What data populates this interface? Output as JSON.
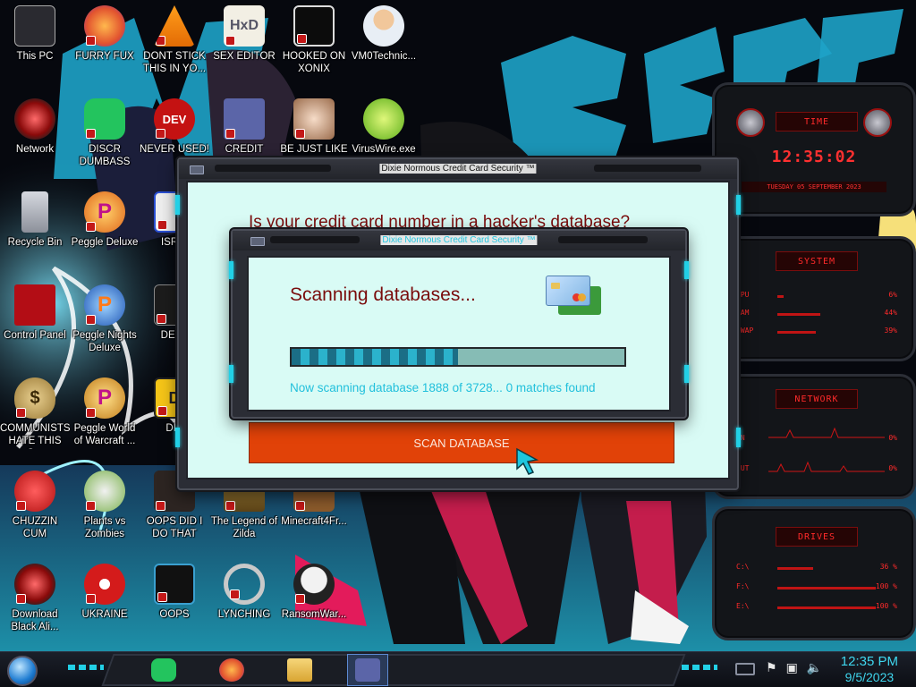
{
  "desktop_icons": [
    {
      "label": "This PC",
      "icon": "this-pc-icon",
      "shortcut": false
    },
    {
      "label": "FURRY FUX",
      "icon": "firefox-icon",
      "shortcut": true
    },
    {
      "label": "DONT STICK THIS IN YO...",
      "icon": "vlc-icon",
      "shortcut": true
    },
    {
      "label": "SEX EDITOR",
      "icon": "hex-editor-icon",
      "shortcut": true
    },
    {
      "label": "HOOKED ON XONIX",
      "icon": "xonix-icon",
      "shortcut": true
    },
    {
      "label": "VM0Technic...",
      "icon": "technician-icon",
      "shortcut": false
    },
    {
      "label": "Network",
      "icon": "network-icon",
      "shortcut": false
    },
    {
      "label": "DISCR DUMBASS",
      "icon": "discord-icon",
      "shortcut": true
    },
    {
      "label": "NEVER USED!",
      "icon": "devcpp-icon",
      "shortcut": true
    },
    {
      "label": "CREDIT CARD",
      "icon": "credit-card-icon",
      "shortcut": true
    },
    {
      "label": "BE JUST LIKE",
      "icon": "santa-icon",
      "shortcut": true
    },
    {
      "label": "VirusWire.exe",
      "icon": "lime-icon",
      "shortcut": false
    },
    {
      "label": "Recycle Bin",
      "icon": "recycle-bin-icon",
      "shortcut": false
    },
    {
      "label": "Peggle Deluxe",
      "icon": "peggle-icon",
      "shortcut": true
    },
    {
      "label": "ISRAI",
      "icon": "israel-icon",
      "shortcut": true
    },
    {
      "label": "Control Panel",
      "icon": "control-panel-icon",
      "shortcut": false
    },
    {
      "label": "Peggle Nights Deluxe",
      "icon": "peggle-nights-icon",
      "shortcut": true
    },
    {
      "label": "DEEZ",
      "icon": "deez-icon",
      "shortcut": true
    },
    {
      "label": "COMMUNISTS HATE THIS G...",
      "icon": "money-bag-icon",
      "shortcut": true
    },
    {
      "label": "Peggle World of Warcraft ...",
      "icon": "peggle-wow-icon",
      "shortcut": true
    },
    {
      "label": "DIE",
      "icon": "die-icon",
      "shortcut": true
    },
    {
      "label": "CHUZZIN CUM",
      "icon": "chuzzle-icon",
      "shortcut": true
    },
    {
      "label": "Plants vs Zombies",
      "icon": "pvz-icon",
      "shortcut": true
    },
    {
      "label": "OOPS DID I DO THAT",
      "icon": "urkel-icon",
      "shortcut": true
    },
    {
      "label": "The Legend of Zilda",
      "icon": "zelda-icon",
      "shortcut": true
    },
    {
      "label": "Minecraft4Fr...",
      "icon": "minecraft-icon",
      "shortcut": true
    },
    {
      "label": "Download Black Ali...",
      "icon": "alienware-icon",
      "shortcut": true
    },
    {
      "label": "UKRAINE",
      "icon": "radiation-icon",
      "shortcut": true
    },
    {
      "label": "OOPS",
      "icon": "oops-icon",
      "shortcut": true
    },
    {
      "label": "LYNCHING",
      "icon": "noose-icon",
      "shortcut": true
    },
    {
      "label": "RansomWar...",
      "icon": "skull-icon",
      "shortcut": true
    }
  ],
  "back_window": {
    "title": "Dixie Normous Credit Card Security ™",
    "question": "Is your credit card number in a hacker's database?",
    "scan_button_label": "SCAN DATABASE"
  },
  "front_window": {
    "title": "Dixie Normous Credit Card Security ™",
    "heading": "Scanning databases...",
    "progress_fraction": 0.5,
    "status_text": "Now scanning database 1888 of 3728... 0 matches found"
  },
  "widgets": {
    "time": {
      "title": "TIME",
      "clock": "12:35:02",
      "date": "TUESDAY 05 SEPTEMBER 2023"
    },
    "system": {
      "title": "SYSTEM",
      "rows": [
        {
          "key": "CPU",
          "value": "6%",
          "level": 0.06
        },
        {
          "key": "RAM",
          "value": "44%",
          "level": 0.44
        },
        {
          "key": "SWAP",
          "value": "39%",
          "level": 0.39
        }
      ]
    },
    "network": {
      "title": "NETWORK",
      "rows": [
        {
          "key": "IN",
          "value": "0%"
        },
        {
          "key": "OUT",
          "value": "0%"
        }
      ]
    },
    "drives": {
      "title": "DRIVES",
      "rows": [
        {
          "key": "C:\\",
          "value": "36 %"
        },
        {
          "key": "F:\\",
          "value": "100 %"
        },
        {
          "key": "E:\\",
          "value": "100 %"
        }
      ]
    }
  },
  "taskbar": {
    "clock_time": "12:35 PM",
    "clock_date": "9/5/2023",
    "pinned": [
      {
        "icon": "discord-icon"
      },
      {
        "icon": "firefox-icon"
      },
      {
        "icon": "file-explorer-icon"
      },
      {
        "icon": "credit-card-app-icon",
        "active": true
      }
    ],
    "tray": [
      {
        "icon": "flag-icon"
      },
      {
        "icon": "network-icon"
      },
      {
        "icon": "volume-icon"
      }
    ]
  },
  "colors": {
    "accent_cyan": "#22d0e6",
    "window_bg": "#d9fbf5",
    "heading_red": "#7a0c0c",
    "scan_button": "#e14208",
    "widget_red": "#ff2a2a"
  }
}
